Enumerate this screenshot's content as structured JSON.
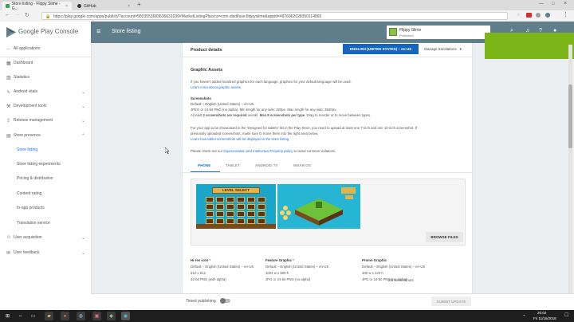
{
  "browser": {
    "tabs": [
      {
        "label": "Store listing - Flippy Slime - G...",
        "active": true
      },
      {
        "label": "GitHub",
        "active": false
      }
    ],
    "new_tab": "+",
    "url": "https://play.google.com/apps/publish/?account=5503553683636631039#MarketListingPlace:p=com.disdifuse.flippyslime&appid=4976062028350114865"
  },
  "sidebar": {
    "brand": "Google Play Console",
    "items": [
      {
        "label": "All applications",
        "icon": "arrow-back-icon"
      },
      {
        "label": "Dashboard",
        "icon": "dashboard-icon"
      },
      {
        "label": "Statistics",
        "icon": "statistics-icon"
      },
      {
        "label": "Android vitals",
        "icon": "vitals-icon"
      },
      {
        "label": "Development tools",
        "icon": "tools-icon"
      },
      {
        "label": "Release management",
        "icon": "rocket-icon"
      },
      {
        "label": "Store presence",
        "icon": "store-icon"
      },
      {
        "label": "Store listing",
        "sub": true,
        "selected": true
      },
      {
        "label": "Store listing experiments",
        "sub": true
      },
      {
        "label": "Pricing & distribution",
        "sub": true
      },
      {
        "label": "Content rating",
        "sub": true
      },
      {
        "label": "In-app products",
        "sub": true
      },
      {
        "label": "Translation service",
        "sub": true
      },
      {
        "label": "User acquisition",
        "icon": "user-add-icon"
      },
      {
        "label": "User feedback",
        "icon": "feedback-icon"
      }
    ]
  },
  "header": {
    "title": "Store listing",
    "app_name": "Flippy Slime",
    "app_status": "Published"
  },
  "main": {
    "section_title": "Product details",
    "language_button": "ENGLISH (UNITED STATES) – en-US",
    "manage_translations": "Manage translations",
    "graphic_assets": {
      "title": "Graphic Assets",
      "intro": "If you haven't added localized graphics for each language, graphics for your default language will be used.",
      "learn_more": "Learn more about graphic assets",
      "screenshots_label": "Screenshots",
      "screenshots_lang": "Default – English (United States) – en-US",
      "screenshots_format": "JPEG or 24-bit PNG (no alpha). Min length for any side: 320px. Max length for any side: 3840px.",
      "screenshots_rule_prefix": "At least ",
      "screenshots_rule_b1": "2 screenshots are required",
      "screenshots_rule_mid": " overall. ",
      "screenshots_rule_b2": "Max 8 screenshots per type",
      "screenshots_rule_suffix": ". Drag to reorder or to move between types.",
      "designed_for_1": "For your app to be showcased in the 'Designed for tablets' list in the Play Store, you need to upload at least one 7-inch and one 10-inch screenshot. If",
      "designed_for_2": "previously uploaded screenshots, make sure to move them into the right area below.",
      "tablet_link": "Learn how tablet screenshots will be displayed in the store listing",
      "policy_prefix": "Please check out our ",
      "policy_link": "Impersonation and Intellectual Property policy",
      "policy_suffix": " to avoid common violations.",
      "device_tabs": [
        "PHONE",
        "TABLET",
        "ANDROID TV",
        "WEAR OS"
      ],
      "screenshot_1_title": "LEVEL SELECT",
      "screenshot_count": "2/8 screenshots",
      "browse_files": "BROWSE FILES",
      "assets": [
        {
          "title": "Hi-res icon",
          "lang": "Default – English (United States) – en-US",
          "size": "512 x 512",
          "format": "32-bit PNG (with alpha)"
        },
        {
          "title": "Feature Graphic",
          "lang": "Default – English (United States) – en-US",
          "size": "1024 w x 500 h",
          "format": "JPG or 24-bit PNG (no alpha)"
        },
        {
          "title": "Promo Graphic",
          "lang": "Default – English (United States) – en-US",
          "size": "180 w x 120 h",
          "format": "JPG or 24-bit PNG (no alpha)"
        }
      ]
    }
  },
  "footer": {
    "timed_publishing": "Timed publishing",
    "submit_update": "SUBMIT UPDATE"
  },
  "taskbar": {
    "time": "20:02",
    "date": "Fri 11/16/2018"
  },
  "colors": {
    "header": "#607d8b",
    "accent": "#1a73e8",
    "language_button": "#1565c0",
    "overlay_green": "#7cb518"
  }
}
